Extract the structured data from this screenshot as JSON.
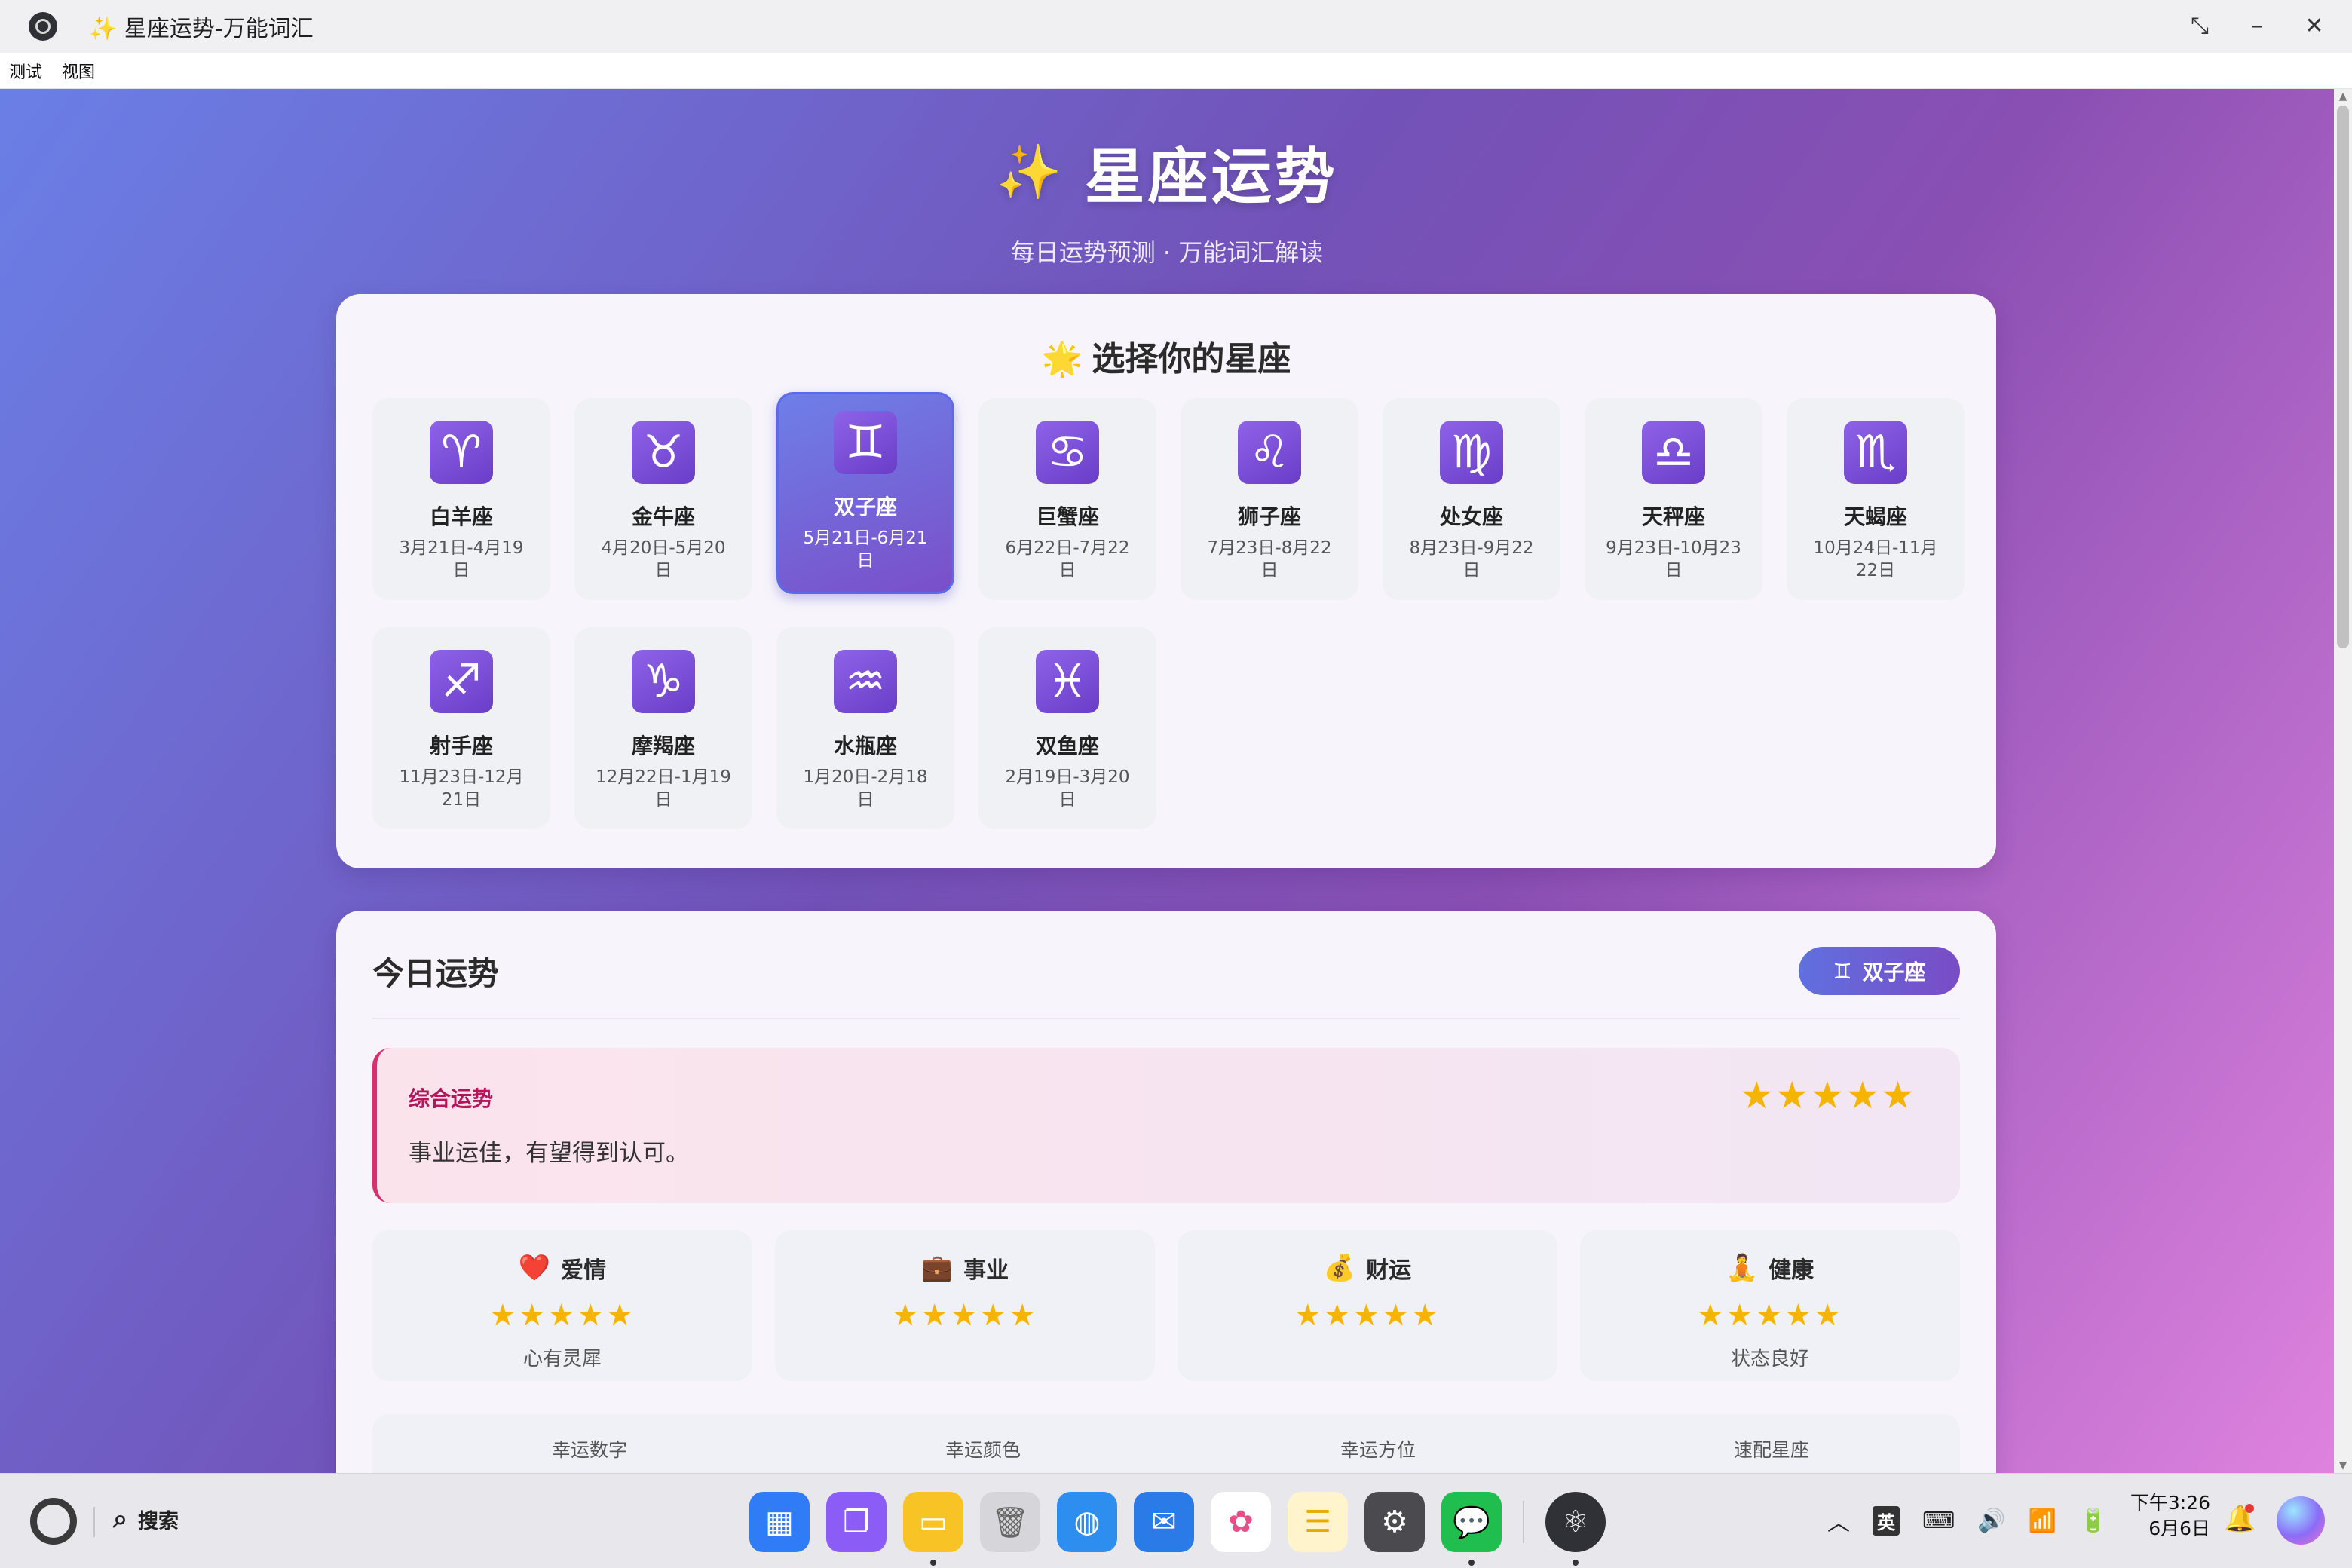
{
  "window": {
    "title": "✨ 星座运势-万能词汇"
  },
  "menu": [
    "测试",
    "视图"
  ],
  "hero": {
    "sparkle": "✨",
    "title": "星座运势",
    "subtitle": "每日运势预测 · 万能词汇解读"
  },
  "selector": {
    "icon": "🌟",
    "title": "选择你的星座",
    "signs": [
      {
        "symbol": "♈",
        "name": "白羊座",
        "dates": "3月21日-4月19日"
      },
      {
        "symbol": "♉",
        "name": "金牛座",
        "dates": "4月20日-5月20日"
      },
      {
        "symbol": "♊",
        "name": "双子座",
        "dates": "5月21日-6月21日"
      },
      {
        "symbol": "♋",
        "name": "巨蟹座",
        "dates": "6月22日-7月22日"
      },
      {
        "symbol": "♌",
        "name": "狮子座",
        "dates": "7月23日-8月22日"
      },
      {
        "symbol": "♍",
        "name": "处女座",
        "dates": "8月23日-9月22日"
      },
      {
        "symbol": "♎",
        "name": "天秤座",
        "dates": "9月23日-10月23日"
      },
      {
        "symbol": "♏",
        "name": "天蝎座",
        "dates": "10月24日-11月22日"
      },
      {
        "symbol": "♐",
        "name": "射手座",
        "dates": "11月23日-12月21日"
      },
      {
        "symbol": "♑",
        "name": "摩羯座",
        "dates": "12月22日-1月19日"
      },
      {
        "symbol": "♒",
        "name": "水瓶座",
        "dates": "1月20日-2月18日"
      },
      {
        "symbol": "♓",
        "name": "双鱼座",
        "dates": "2月19日-3月20日"
      }
    ],
    "selected_index": 2
  },
  "fortune": {
    "heading": "今日运势",
    "badge": {
      "symbol": "♊",
      "label": "双子座"
    },
    "overall": {
      "label": "综合运势",
      "text": "事业运佳，有望得到认可。",
      "stars": "★★★★★",
      "rating": 5
    },
    "aspects": [
      {
        "emoji": "❤️",
        "name": "爱情",
        "stars": "★★★★★",
        "desc": "心有灵犀"
      },
      {
        "emoji": "💼",
        "name": "事业",
        "stars": "★★★★★",
        "desc": ""
      },
      {
        "emoji": "💰",
        "name": "财运",
        "stars": "★★★★★",
        "desc": ""
      },
      {
        "emoji": "🧘",
        "name": "健康",
        "stars": "★★★★★",
        "desc": "状态良好"
      }
    ],
    "lucky": [
      {
        "label": "幸运数字"
      },
      {
        "label": "幸运颜色"
      },
      {
        "label": "幸运方位"
      },
      {
        "label": "速配星座"
      }
    ]
  },
  "taskbar": {
    "search_label": "搜索",
    "ime": "英",
    "time": "下午3:26",
    "date": "6月6日"
  },
  "colors": {
    "accent": "#7a4cc6",
    "overall_label": "#b5155b",
    "star": "#f5b400"
  }
}
